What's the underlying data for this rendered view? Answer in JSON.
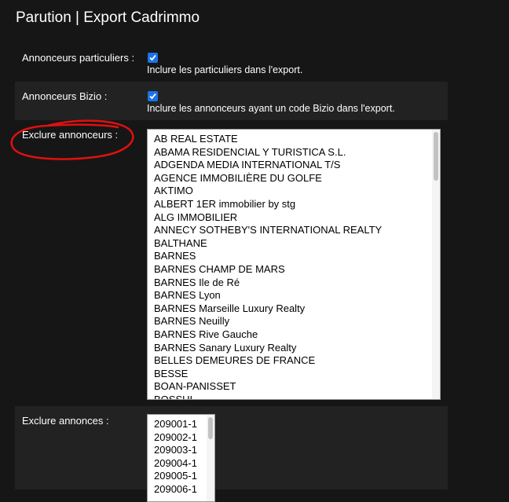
{
  "page": {
    "title": "Parution | Export Cadrimmo"
  },
  "rows": {
    "particuliers": {
      "label": "Annonceurs particuliers :",
      "checked": true,
      "help": "Inclure les particuliers dans l'export."
    },
    "bizio": {
      "label": "Annonceurs Bizio :",
      "checked": true,
      "help": "Inclure les annonceurs ayant un code Bizio dans l'export."
    },
    "exclure_annonceurs": {
      "label": "Exclure annonceurs :",
      "options": [
        "AB REAL ESTATE",
        "ABAMA RESIDENCIAL Y TURISTICA S.L.",
        "ADGENDA MEDIA INTERNATIONAL T/S",
        "AGENCE IMMOBILIÈRE DU GOLFE",
        "AKTIMO",
        "ALBERT 1ER immobilier by stg",
        "ALG IMMOBILIER",
        "ANNECY SOTHEBY'S INTERNATIONAL REALTY",
        "BALTHANE",
        "BARNES",
        "BARNES CHAMP DE MARS",
        "BARNES Ile de Ré",
        "BARNES Lyon",
        "BARNES Marseille Luxury Realty",
        "BARNES Neuilly",
        "BARNES Rive Gauche",
        "BARNES Sanary Luxury Realty",
        "BELLES DEMEURES DE FRANCE",
        "BESSE",
        "BOAN-PANISSET",
        "BOSSUI"
      ]
    },
    "exclure_annonces": {
      "label": "Exclure annonces :",
      "options": [
        "209001-1",
        "209002-1",
        "209003-1",
        "209004-1",
        "209005-1",
        "209006-1"
      ]
    }
  },
  "colors": {
    "checkbox": "#1a73e8",
    "annotation": "#e01010"
  }
}
